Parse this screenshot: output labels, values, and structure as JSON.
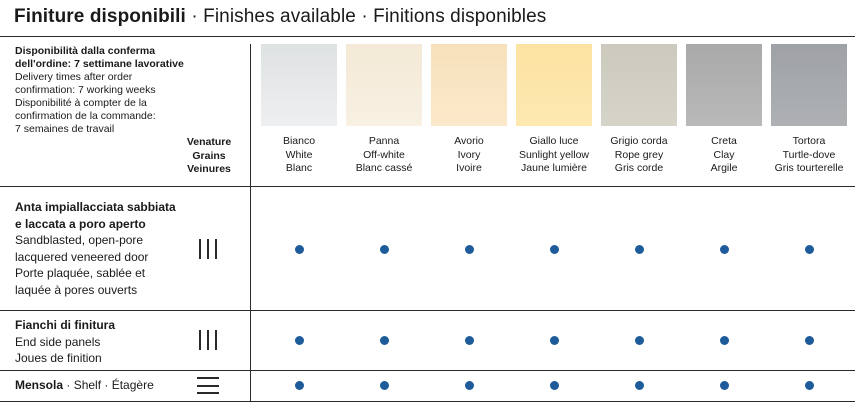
{
  "title": {
    "it": "Finiture disponibili",
    "en": "Finishes available",
    "fr": "Finitions disponibles",
    "separator": " · "
  },
  "delivery": {
    "it_line1": "Disponibilità dalla conferma",
    "it_line2": "dell'ordine: 7 settimane lavorative",
    "en_line1": "Delivery times after order",
    "en_line2": "confirmation: 7 working weeks",
    "fr_line1": "Disponibilité à compter de la",
    "fr_line2": "confirmation de la commande:",
    "fr_line3": "7 semaines de travail"
  },
  "grains_header": {
    "it": "Venature",
    "en": "Grains",
    "fr": "Veinures"
  },
  "finishes": [
    {
      "it": "Bianco",
      "en": "White",
      "fr": "Blanc",
      "color_top": "#dfe2e3",
      "color_bottom": "#edeff0"
    },
    {
      "it": "Panna",
      "en": "Off-white",
      "fr": "Blanc cassé",
      "color_top": "#f4e9d6",
      "color_bottom": "#f8f0e3"
    },
    {
      "it": "Avorio",
      "en": "Ivory",
      "fr": "Ivoire",
      "color_top": "#f7e1bb",
      "color_bottom": "#fae9ca"
    },
    {
      "it": "Giallo luce",
      "en": "Sunlight yellow",
      "fr": "Jaune lumière",
      "color_top": "#fde3a2",
      "color_bottom": "#fde8b0"
    },
    {
      "it": "Grigio corda",
      "en": "Rope grey",
      "fr": "Gris corde",
      "color_top": "#ccc9bd",
      "color_bottom": "#d6d4c9"
    },
    {
      "it": "Creta",
      "en": "Clay",
      "fr": "Argile",
      "color_top": "#a9a9a9",
      "color_bottom": "#b9b9b9"
    },
    {
      "it": "Tortora",
      "en": "Turtle-dove",
      "fr": "Gris tourterelle",
      "color_top": "#9ea1a5",
      "color_bottom": "#aeb1b4"
    }
  ],
  "rows": [
    {
      "it_line1": "Anta impiallacciata sabbiata",
      "it_line2": "e laccata a poro aperto",
      "en_line1": "Sandblasted, open-pore",
      "en_line2": "lacquered veneered door",
      "fr_line1": "Porte plaquée, sablée et",
      "fr_line2": "laquée à pores ouverts",
      "grain": "vertical-grain-icon",
      "available": [
        true,
        true,
        true,
        true,
        true,
        true,
        true
      ]
    },
    {
      "it": "Fianchi di finitura",
      "en": "End side panels",
      "fr": "Joues de finition",
      "grain": "vertical-grain-icon",
      "available": [
        true,
        true,
        true,
        true,
        true,
        true,
        true
      ]
    },
    {
      "it": "Mensola",
      "en": "Shelf",
      "fr": "Étagère",
      "separator": " · ",
      "grain": "horizontal-grain-icon",
      "available": [
        true,
        true,
        true,
        true,
        true,
        true,
        true
      ]
    }
  ],
  "colors": {
    "dot": "#1d5b9a",
    "rule": "#2a2a2a"
  }
}
